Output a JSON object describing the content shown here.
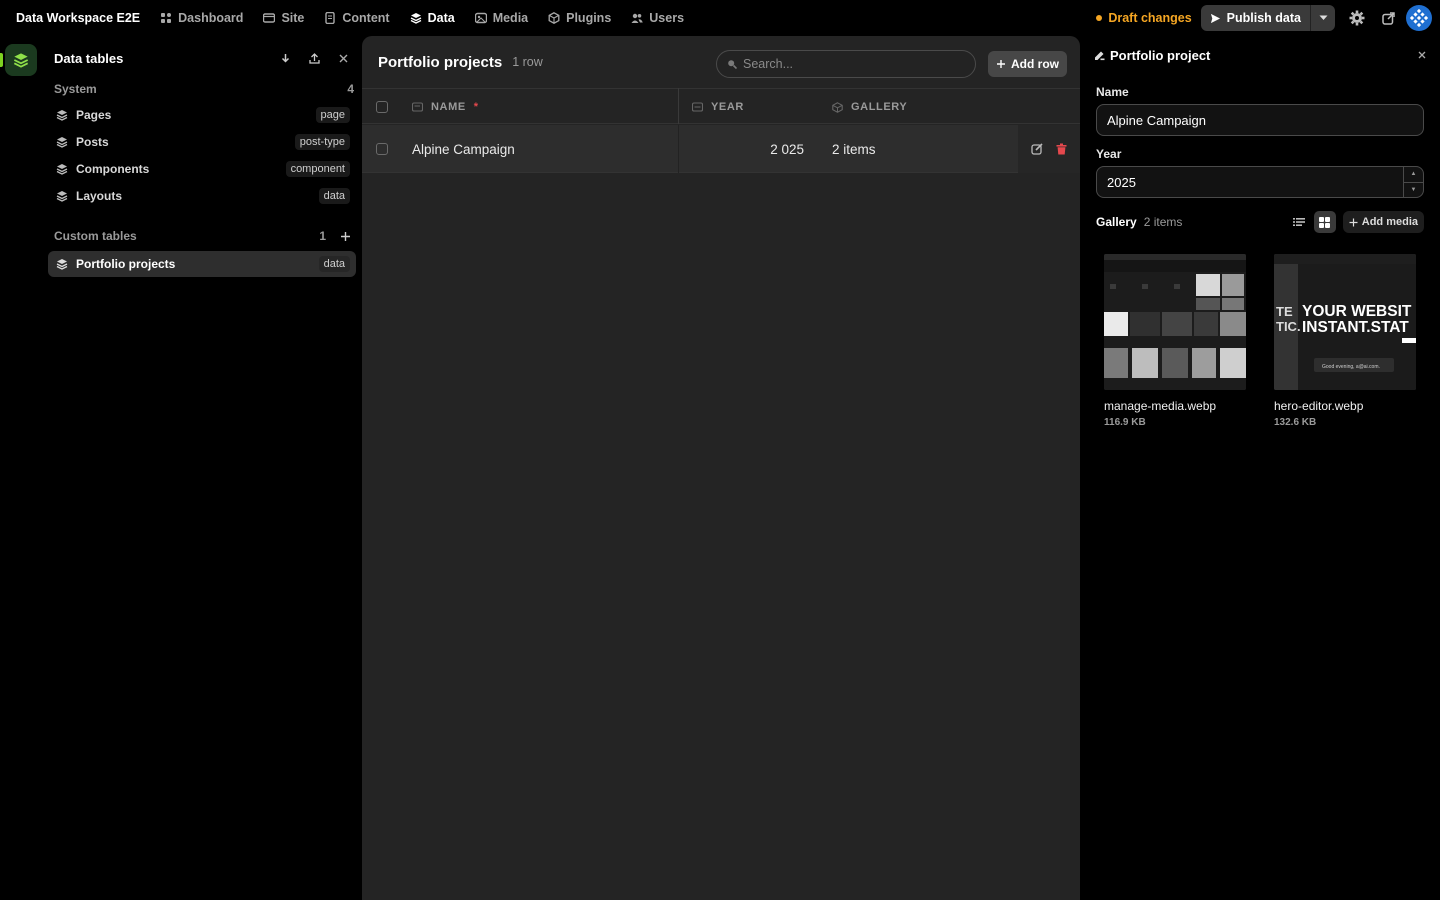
{
  "app": {
    "title": "Data Workspace E2E"
  },
  "nav": {
    "items": [
      {
        "label": "Dashboard",
        "icon": "dashboard-icon"
      },
      {
        "label": "Site",
        "icon": "site-icon"
      },
      {
        "label": "Content",
        "icon": "content-icon"
      },
      {
        "label": "Data",
        "icon": "database-icon",
        "active": true
      },
      {
        "label": "Media",
        "icon": "media-icon"
      },
      {
        "label": "Plugins",
        "icon": "plugin-icon"
      },
      {
        "label": "Users",
        "icon": "users-icon"
      }
    ]
  },
  "topbar": {
    "draft_label": "Draft changes",
    "publish_label": "Publish data",
    "colors": {
      "draft": "#f5a623",
      "accent": "#7ed321"
    }
  },
  "sidebar": {
    "title": "Data tables",
    "system": {
      "label": "System",
      "count": "4"
    },
    "system_items": [
      {
        "label": "Pages",
        "badge": "page"
      },
      {
        "label": "Posts",
        "badge": "post-type"
      },
      {
        "label": "Components",
        "badge": "component"
      },
      {
        "label": "Layouts",
        "badge": "data"
      }
    ],
    "custom": {
      "label": "Custom tables",
      "count": "1"
    },
    "custom_items": [
      {
        "label": "Portfolio projects",
        "badge": "data",
        "selected": true
      }
    ]
  },
  "main": {
    "title": "Portfolio projects",
    "row_count": "1 row",
    "search_placeholder": "Search...",
    "add_row_label": "Add row",
    "columns": {
      "name": "NAME",
      "required_mark": "*",
      "year": "YEAR",
      "gallery": "GALLERY"
    },
    "rows": [
      {
        "name": "Alpine Campaign",
        "year": "2 025",
        "gallery": "2 items"
      }
    ]
  },
  "editor": {
    "title": "Portfolio project",
    "name_label": "Name",
    "name_value": "Alpine Campaign",
    "year_label": "Year",
    "year_value": "2025",
    "gallery_label": "Gallery",
    "gallery_count": "2 items",
    "add_media_label": "Add media",
    "media": [
      {
        "name": "manage-media.webp",
        "size": "116.9 KB"
      },
      {
        "name": "hero-editor.webp",
        "size": "132.6 KB",
        "thumb_text_1": "YOUR WEBSIT",
        "thumb_text_2": "INSTANT.STAT",
        "thumb_text_3": "Good evening, a@ai.com.",
        "thumb_text_4": "TE",
        "thumb_text_5": "TIC."
      }
    ]
  }
}
